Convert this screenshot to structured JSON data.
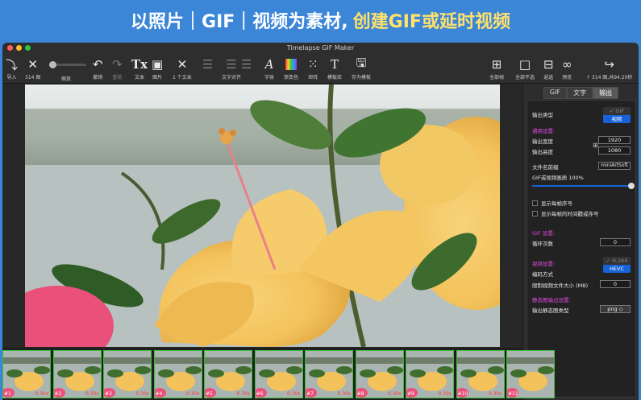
{
  "banner": {
    "part1": "以照片｜GIF｜视频为素材,",
    "part2": "创建GIF或延时视频"
  },
  "window": {
    "title": "Timelapse GIF Maker"
  },
  "toolbar": {
    "import": "导入",
    "count": "314 图",
    "zoom": "缩放",
    "undo": "撤销",
    "redo": "重做",
    "text": "文本",
    "image": "图片",
    "text_count": "1 个文本",
    "align": "文字对齐",
    "font": "字体",
    "gradient": "渐变色",
    "matrix": "矩阵",
    "template_lib": "模板库",
    "save_template": "存为模板",
    "select_all": "全部帧",
    "deselect_all": "全部不选",
    "invert": "返选",
    "preview": "预览",
    "export_info": "↑ 314 图,共94.20秒"
  },
  "panel": {
    "tabs": [
      "GIF",
      "文字",
      "输出"
    ],
    "output_type": "输出类型",
    "gif_opt": "✓ GIF",
    "video_opt": "视频",
    "general": "通用设置:",
    "out_width": "输出宽度",
    "width_val": "1920",
    "out_height": "输出高度",
    "height_val": "1080",
    "prefix": "文件名前缀",
    "prefix_val": "miniArtSoft",
    "quality": "GIF或视频画质 100%",
    "quality_value": 1.0,
    "show_index": "显示每帧序号",
    "show_time": "显示每帧的时间戳或序号",
    "gif_settings": "GIF 设置:",
    "loops": "循环次数",
    "loops_val": "0",
    "video_settings": "视频设置:",
    "codec": "编码方式",
    "h264": "✓ H.264",
    "hevc": "HEVC",
    "limit_size": "限制视频文件大小 (MB)",
    "limit_val": "0",
    "still_settings": "静态图输出设置:",
    "still_type": "输出静态图类型",
    "still_val": "png ◇"
  },
  "frames": [
    {
      "n": "#1",
      "t": "0.30s"
    },
    {
      "n": "#2",
      "t": "0.30s"
    },
    {
      "n": "#3",
      "t": "0.30s"
    },
    {
      "n": "#4",
      "t": "0.30s"
    },
    {
      "n": "#5",
      "t": "0.30s"
    },
    {
      "n": "#6",
      "t": "0.30s"
    },
    {
      "n": "#7",
      "t": "0.30s"
    },
    {
      "n": "#8",
      "t": "0.30s"
    },
    {
      "n": "#9",
      "t": "0.30s"
    },
    {
      "n": "#10",
      "t": "0.30s"
    },
    {
      "n": "#11",
      "t": ""
    }
  ]
}
